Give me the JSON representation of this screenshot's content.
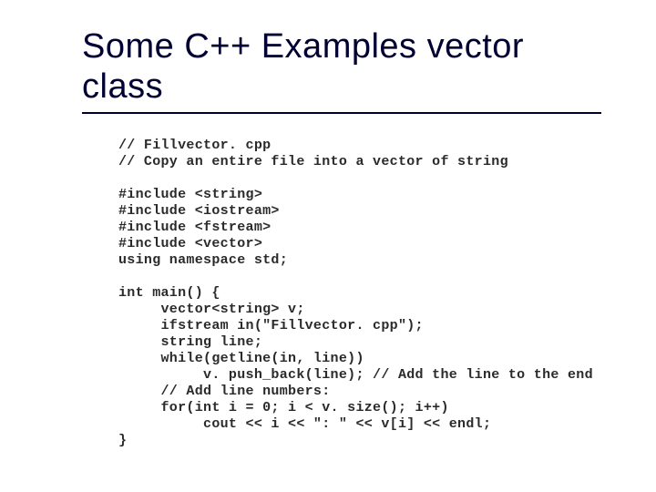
{
  "title": "Some C++ Examples vector class",
  "code": "// Fillvector. cpp\n// Copy an entire file into a vector of string\n\n#include <string>\n#include <iostream>\n#include <fstream>\n#include <vector>\nusing namespace std;\n\nint main() {\n     vector<string> v;\n     ifstream in(\"Fillvector. cpp\");\n     string line;\n     while(getline(in, line))\n          v. push_back(line); // Add the line to the end\n     // Add line numbers:\n     for(int i = 0; i < v. size(); i++)\n          cout << i << \": \" << v[i] << endl;\n}"
}
